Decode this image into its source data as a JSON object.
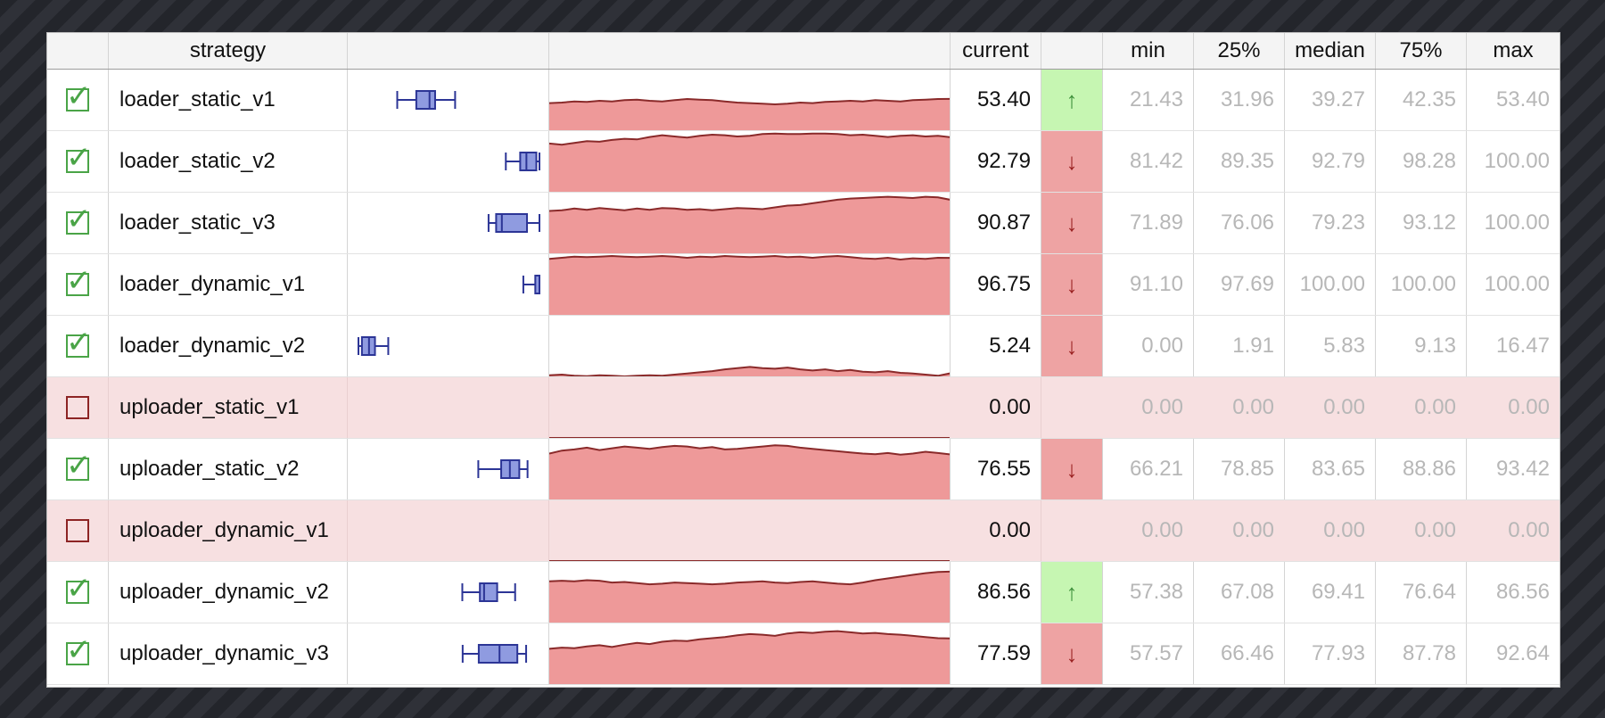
{
  "columns": {
    "check": "",
    "strategy": "strategy",
    "distribution": "",
    "history": "",
    "current": "current",
    "trend": "",
    "min": "min",
    "q25": "25%",
    "median": "median",
    "q75": "75%",
    "max": "max"
  },
  "colors": {
    "spark_fill": "#ee9999",
    "spark_line": "#8a2a2a",
    "box_fill": "#8f9be0",
    "box_stroke": "#2c3596",
    "trend_up": "#c6f6b2",
    "trend_down": "#eea3a3",
    "disabled_row": "#f7e0e1"
  },
  "rows": [
    {
      "enabled": true,
      "strategy": "loader_static_v1",
      "current": "53.40",
      "trend": "up",
      "trend_icon": "↑",
      "min": "21.43",
      "q25": "31.96",
      "median": "39.27",
      "q75": "42.35",
      "max": "53.40",
      "sparkline": [
        46,
        47,
        49,
        48,
        50,
        49,
        51,
        52,
        50,
        49,
        51,
        53,
        52,
        51,
        49,
        47,
        46,
        45,
        44,
        45,
        47,
        46,
        48,
        49,
        50,
        49,
        51,
        50,
        49,
        51,
        52,
        53,
        53.4
      ]
    },
    {
      "enabled": true,
      "strategy": "loader_static_v2",
      "current": "92.79",
      "trend": "down",
      "trend_icon": "↓",
      "min": "81.42",
      "q25": "89.35",
      "median": "92.79",
      "q75": "98.28",
      "max": "100.00",
      "sparkline": [
        82,
        80,
        83,
        86,
        85,
        88,
        90,
        89,
        93,
        96,
        94,
        92,
        95,
        97,
        96,
        94,
        95,
        98,
        99,
        98,
        98,
        99,
        99,
        98,
        96,
        97,
        95,
        93,
        95,
        96,
        94,
        95,
        92.79
      ]
    },
    {
      "enabled": true,
      "strategy": "loader_static_v3",
      "current": "90.87",
      "trend": "down",
      "trend_icon": "↓",
      "min": "71.89",
      "q25": "76.06",
      "median": "79.23",
      "q75": "93.12",
      "max": "100.00",
      "sparkline": [
        72,
        73,
        76,
        74,
        77,
        75,
        73,
        76,
        74,
        77,
        76,
        74,
        75,
        73,
        75,
        77,
        76,
        75,
        78,
        81,
        82,
        85,
        88,
        91,
        93,
        94,
        95,
        96,
        95,
        94,
        96,
        95,
        90.87
      ]
    },
    {
      "enabled": true,
      "strategy": "loader_dynamic_v1",
      "current": "96.75",
      "trend": "down",
      "trend_icon": "↓",
      "min": "91.10",
      "q25": "97.69",
      "median": "100.00",
      "q75": "100.00",
      "max": "100.00",
      "sparkline": [
        95,
        97,
        99,
        98,
        99,
        100,
        99,
        98,
        99,
        100,
        99,
        97,
        99,
        98,
        100,
        99,
        98,
        99,
        100,
        98,
        99,
        97,
        99,
        100,
        98,
        96,
        95,
        97,
        94,
        96,
        95,
        97,
        96.75
      ]
    },
    {
      "enabled": true,
      "strategy": "loader_dynamic_v2",
      "current": "5.24",
      "trend": "down",
      "trend_icon": "↓",
      "min": "0.00",
      "q25": "1.91",
      "median": "5.83",
      "q75": "9.13",
      "max": "16.47",
      "sparkline": [
        2,
        3,
        1,
        0.5,
        2,
        1,
        0,
        1,
        2,
        1,
        3,
        5,
        7,
        9,
        12,
        14,
        16,
        14,
        13,
        15,
        12,
        10,
        12,
        9,
        11,
        8,
        7,
        9,
        6,
        5,
        3,
        1,
        5.24
      ]
    },
    {
      "enabled": false,
      "strategy": "uploader_static_v1",
      "current": "0.00",
      "trend": "none",
      "trend_icon": "",
      "min": "0.00",
      "q25": "0.00",
      "median": "0.00",
      "q75": "0.00",
      "max": "0.00",
      "sparkline": [
        0,
        0,
        0,
        0,
        0,
        0,
        0,
        0,
        0,
        0,
        0,
        0,
        0,
        0,
        0,
        0,
        0,
        0,
        0,
        0,
        0,
        0,
        0,
        0,
        0,
        0,
        0,
        0,
        0,
        0,
        0,
        0,
        0
      ]
    },
    {
      "enabled": true,
      "strategy": "uploader_static_v2",
      "current": "76.55",
      "trend": "down",
      "trend_icon": "↓",
      "min": "66.21",
      "q25": "78.85",
      "median": "83.65",
      "q75": "88.86",
      "max": "93.42",
      "sparkline": [
        78,
        83,
        85,
        88,
        84,
        87,
        90,
        88,
        86,
        89,
        91,
        90,
        87,
        89,
        85,
        86,
        88,
        90,
        92,
        91,
        88,
        86,
        84,
        82,
        80,
        78,
        77,
        79,
        76,
        78,
        81,
        79,
        76.55
      ]
    },
    {
      "enabled": false,
      "strategy": "uploader_dynamic_v1",
      "current": "0.00",
      "trend": "none",
      "trend_icon": "",
      "min": "0.00",
      "q25": "0.00",
      "median": "0.00",
      "q75": "0.00",
      "max": "0.00",
      "sparkline": [
        0,
        0,
        0,
        0,
        0,
        0,
        0,
        0,
        0,
        0,
        0,
        0,
        0,
        0,
        0,
        0,
        0,
        0,
        0,
        0,
        0,
        0,
        0,
        0,
        0,
        0,
        0,
        0,
        0,
        0,
        0,
        0,
        0
      ]
    },
    {
      "enabled": true,
      "strategy": "uploader_dynamic_v2",
      "current": "86.56",
      "trend": "up",
      "trend_icon": "↑",
      "min": "57.38",
      "q25": "67.08",
      "median": "69.41",
      "q75": "76.64",
      "max": "86.56",
      "sparkline": [
        70,
        71,
        70,
        72,
        71,
        68,
        69,
        67,
        65,
        66,
        68,
        67,
        66,
        65,
        66,
        68,
        69,
        70,
        68,
        67,
        69,
        70,
        68,
        66,
        65,
        68,
        72,
        75,
        78,
        81,
        84,
        86,
        86.56
      ]
    },
    {
      "enabled": true,
      "strategy": "uploader_dynamic_v3",
      "current": "77.59",
      "trend": "down",
      "trend_icon": "↓",
      "min": "57.57",
      "q25": "66.46",
      "median": "77.93",
      "q75": "87.78",
      "max": "92.64",
      "sparkline": [
        60,
        62,
        61,
        64,
        66,
        63,
        67,
        70,
        68,
        72,
        74,
        73,
        76,
        78,
        80,
        83,
        85,
        84,
        82,
        86,
        88,
        87,
        89,
        90,
        88,
        86,
        87,
        85,
        84,
        82,
        80,
        78,
        77.59
      ]
    }
  ]
}
